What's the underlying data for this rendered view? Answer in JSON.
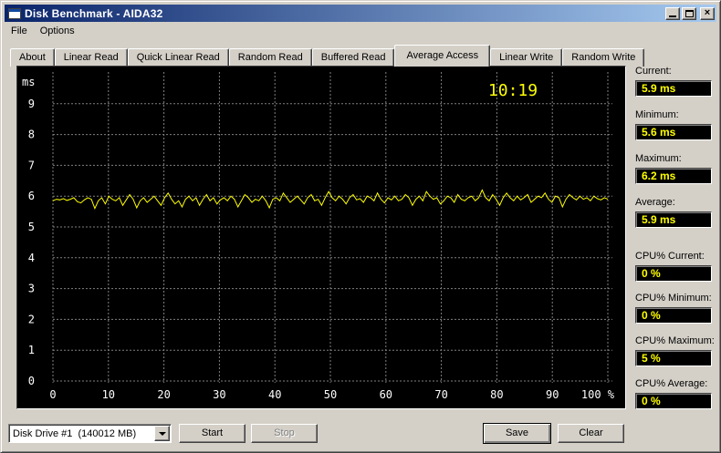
{
  "window": {
    "title": "Disk Benchmark - AIDA32",
    "titlebar_buttons": [
      "minimize",
      "maximize",
      "close"
    ]
  },
  "menu": {
    "items": [
      "File",
      "Options"
    ]
  },
  "tabs": {
    "items": [
      "About",
      "Linear Read",
      "Quick Linear Read",
      "Random Read",
      "Buffered Read",
      "Average Access",
      "Linear Write",
      "Random Write"
    ],
    "active": "Average Access"
  },
  "chart_data": {
    "type": "line",
    "title": "Average Access",
    "ylabel": "ms",
    "xlabel": "%",
    "time_label": "10:19",
    "xlim": [
      0,
      100
    ],
    "ylim": [
      0,
      10
    ],
    "x_ticks": [
      0,
      10,
      20,
      30,
      40,
      50,
      60,
      70,
      80,
      90,
      100
    ],
    "x_tick_labels": [
      "0",
      "10",
      "20",
      "30",
      "40",
      "50",
      "60",
      "70",
      "80",
      "90",
      "100 %"
    ],
    "y_ticks": [
      0,
      1,
      2,
      3,
      4,
      5,
      6,
      7,
      8,
      9
    ],
    "grid": true,
    "line_color": "#ffff00",
    "series": [
      {
        "name": "access_time_ms",
        "values": [
          5.85,
          5.9,
          5.88,
          5.92,
          5.86,
          5.9,
          5.95,
          5.82,
          5.78,
          5.88,
          5.95,
          5.9,
          5.6,
          5.85,
          5.95,
          5.75,
          6.0,
          5.9,
          5.85,
          5.95,
          5.7,
          5.88,
          6.05,
          5.9,
          5.62,
          5.85,
          5.95,
          5.8,
          5.9,
          6.0,
          5.85,
          5.7,
          5.95,
          6.1,
          5.9,
          5.75,
          5.85,
          5.65,
          5.9,
          6.0,
          5.85,
          5.95,
          5.7,
          5.9,
          6.05,
          5.85,
          5.95,
          5.75,
          5.88,
          5.95,
          5.85,
          6.0,
          5.9,
          5.65,
          5.85,
          6.05,
          5.95,
          5.8,
          5.9,
          5.85,
          6.0,
          5.85,
          5.62,
          5.9,
          5.95,
          5.85,
          6.1,
          5.95,
          5.8,
          5.9,
          6.0,
          5.88,
          5.75,
          5.95,
          6.05,
          5.85,
          5.9,
          5.7,
          5.95,
          6.15,
          5.95,
          5.85,
          6.0,
          5.9,
          5.75,
          5.95,
          6.05,
          5.88,
          5.92,
          5.8,
          6.0,
          5.95,
          5.85,
          6.1,
          5.9,
          5.78,
          5.95,
          5.88,
          6.0,
          5.85,
          5.9,
          6.05,
          5.95,
          5.7,
          5.9,
          6.0,
          5.85,
          6.15,
          6.0,
          5.9,
          5.95,
          5.75,
          5.85,
          6.0,
          5.95,
          5.8,
          6.05,
          5.9,
          5.85,
          5.95,
          6.0,
          5.85,
          5.95,
          6.2,
          5.95,
          5.85,
          6.05,
          5.9,
          5.7,
          5.95,
          6.1,
          5.95,
          5.85,
          6.0,
          5.88,
          5.95,
          6.05,
          5.8,
          5.9,
          6.0,
          5.95,
          6.1,
          5.9,
          5.8,
          6.0,
          5.95,
          5.65,
          5.9,
          6.05,
          5.95,
          5.88,
          6.0,
          5.9,
          5.95,
          5.85,
          6.0,
          5.92,
          5.88,
          5.95,
          5.9
        ]
      }
    ]
  },
  "stats": {
    "groups": [
      {
        "label": "Current:",
        "value": "5.9 ms"
      },
      {
        "label": "Minimum:",
        "value": "5.6 ms"
      },
      {
        "label": "Maximum:",
        "value": "6.2 ms"
      },
      {
        "label": "Average:",
        "value": "5.9 ms"
      },
      {
        "label": "CPU% Current:",
        "value": "0 %"
      },
      {
        "label": "CPU% Minimum:",
        "value": "0 %"
      },
      {
        "label": "CPU% Maximum:",
        "value": "5 %"
      },
      {
        "label": "CPU% Average:",
        "value": "0 %"
      }
    ]
  },
  "controls": {
    "drive_select_value": "Disk Drive #1  (140012 MB)",
    "start_label": "Start",
    "stop_label": "Stop",
    "save_label": "Save",
    "clear_label": "Clear"
  },
  "colors": {
    "window_bg": "#d4d0c8",
    "chart_bg": "#000000",
    "grid": "#808080",
    "line": "#ffff00",
    "value_text": "#ffff00",
    "titlebar_left": "#0a246a",
    "titlebar_right": "#a6caf0"
  }
}
